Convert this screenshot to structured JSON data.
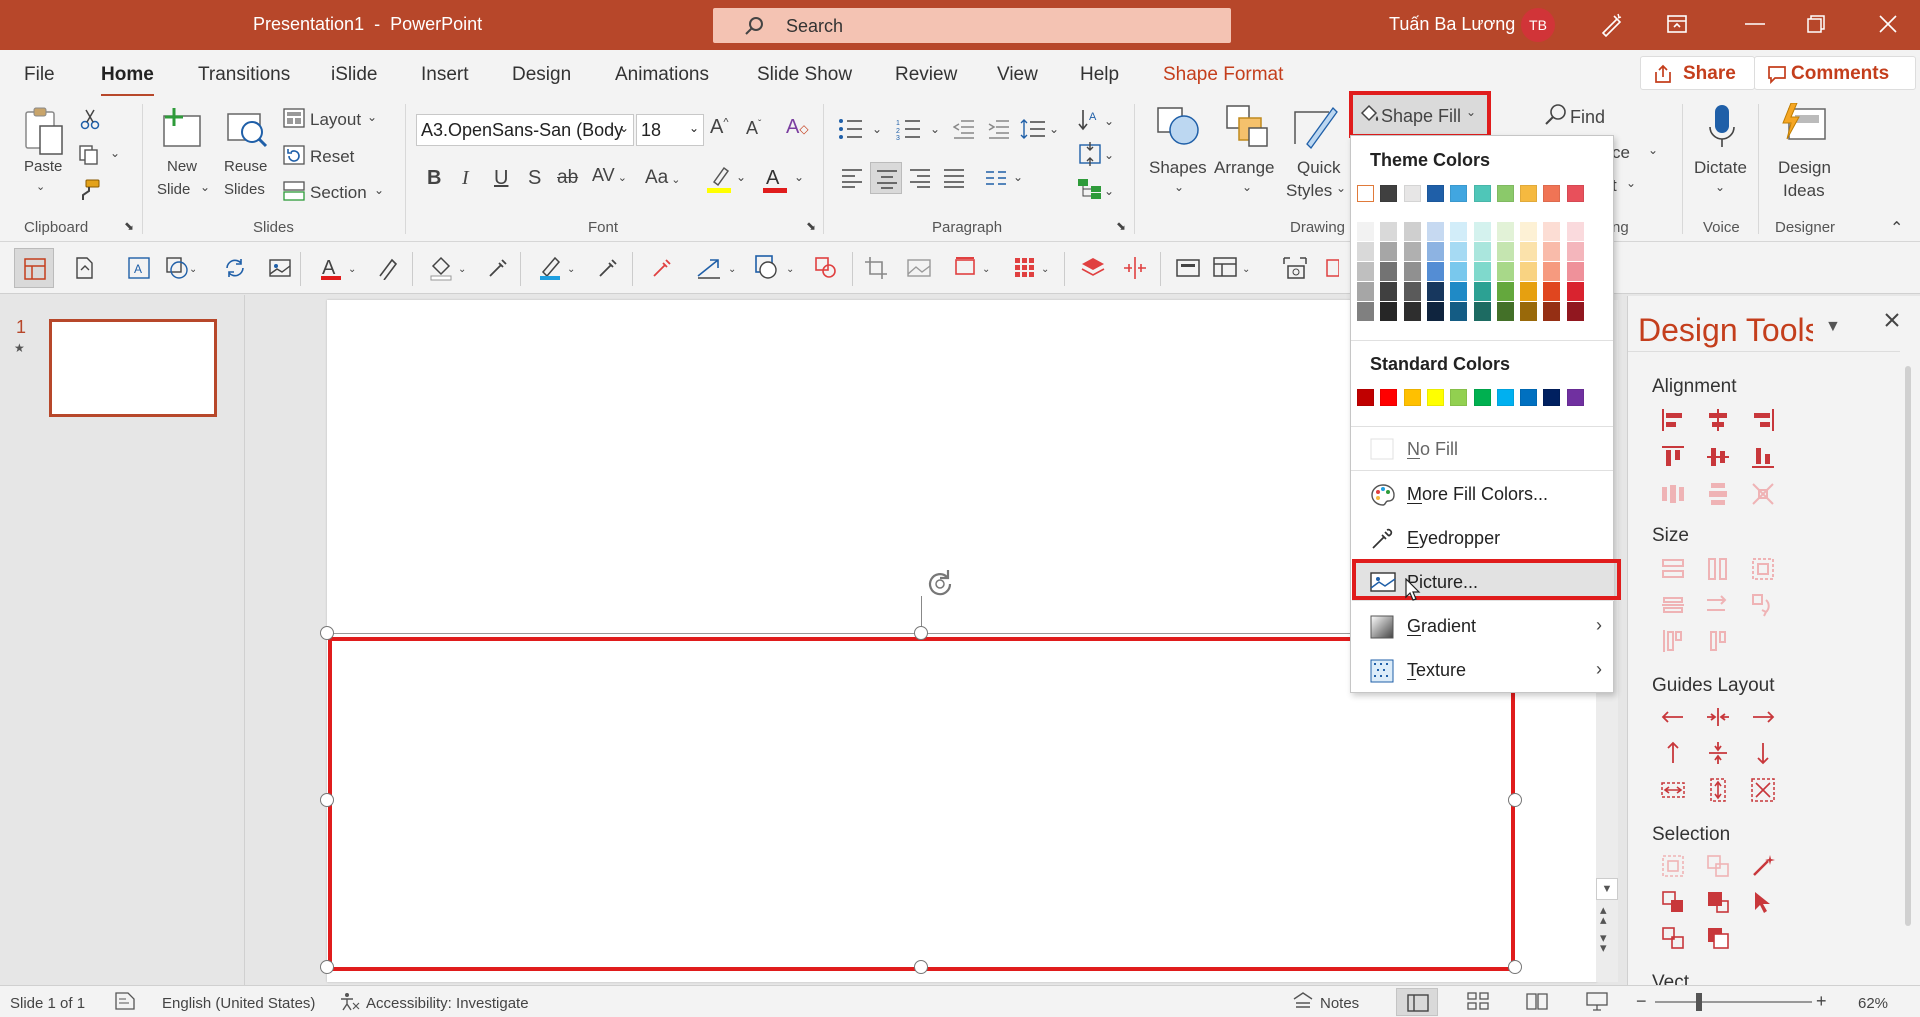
{
  "titlebar": {
    "title": "Presentation1  -  PowerPoint",
    "search_placeholder": "Search",
    "user_name": "Tuấn Ba Lương",
    "user_initials": "TB"
  },
  "tabs": [
    "File",
    "Home",
    "Transitions",
    "iSlide",
    "Insert",
    "Design",
    "Animations",
    "Slide Show",
    "Review",
    "View",
    "Help",
    "Shape Format"
  ],
  "share_label": "Share",
  "comments_label": "Comments",
  "ribbon": {
    "paste": "Paste",
    "new_slide_1": "New",
    "new_slide_2": "Slide",
    "reuse_1": "Reuse",
    "reuse_2": "Slides",
    "layout": "Layout",
    "reset": "Reset",
    "section": "Section",
    "font_name": "A3.OpenSans-San (Body",
    "font_size": "18",
    "shapes": "Shapes",
    "arrange": "Arrange",
    "quick_1": "Quick",
    "quick_2": "Styles",
    "shape_fill": "Shape Fill",
    "find": "Find",
    "frag_ce": "ce",
    "frag_t": "t",
    "frag_ng": "ng",
    "dictate": "Dictate",
    "design_ideas_1": "Design",
    "design_ideas_2": "Ideas",
    "groups": {
      "clipboard": "Clipboard",
      "slides": "Slides",
      "font": "Font",
      "paragraph": "Paragraph",
      "drawing": "Drawing",
      "voice": "Voice",
      "designer": "Designer"
    }
  },
  "thumbnail": {
    "number": "1",
    "star": "★"
  },
  "design_tools": {
    "title": "Design Tools",
    "sections": [
      "Alignment",
      "Size",
      "Guides Layout",
      "Selection",
      "Vect"
    ]
  },
  "dropdown": {
    "theme_colors_label": "Theme Colors",
    "standard_colors_label": "Standard Colors",
    "theme_top": [
      "#ffffff",
      "#404040",
      "#e7e6e6",
      "#1f5fa8",
      "#41a6e0",
      "#4fc6b8",
      "#8bc96a",
      "#f5b940",
      "#f07455",
      "#e8505b"
    ],
    "theme_shades": [
      [
        "#f2f2f2",
        "#d9d9d9",
        "#cfcfcf",
        "#c6d9f1",
        "#d2edf9",
        "#d4f2ee",
        "#e2f2d7",
        "#fdf1d5",
        "#fcddd4",
        "#fadadd"
      ],
      [
        "#d9d9d9",
        "#a6a6a6",
        "#b0b0b0",
        "#8db3e2",
        "#a6daf3",
        "#aae6dd",
        "#c5e5b0",
        "#fbe2ab",
        "#f9bbaa",
        "#f4b6bc"
      ],
      [
        "#bfbfbf",
        "#737373",
        "#909090",
        "#548dd4",
        "#79c8ed",
        "#7fd9cc",
        "#a8d889",
        "#f9d382",
        "#f69a7f",
        "#ef919a"
      ],
      [
        "#a6a6a6",
        "#404040",
        "#5a5a5a",
        "#17375e",
        "#1f8ac6",
        "#2ca193",
        "#64a83d",
        "#e6a010",
        "#e0461f",
        "#d9232f"
      ],
      [
        "#808080",
        "#262626",
        "#2e2e2e",
        "#0f243e",
        "#145c84",
        "#1d6b62",
        "#437028",
        "#99690a",
        "#952f14",
        "#91171f"
      ]
    ],
    "standard": [
      "#c00000",
      "#ff0000",
      "#ffc000",
      "#ffff00",
      "#92d050",
      "#00b050",
      "#00b0f0",
      "#0070c0",
      "#002060",
      "#7030a0"
    ],
    "items": {
      "no_fill": "No Fill",
      "more_colors": "More Fill Colors...",
      "eyedropper": "Eyedropper",
      "picture": "Picture...",
      "gradient": "Gradient",
      "texture": "Texture"
    }
  },
  "statusbar": {
    "slide_info": "Slide 1 of 1",
    "language": "English (United States)",
    "accessibility": "Accessibility: Investigate",
    "notes": "Notes",
    "zoom": "62%",
    "minus": "−",
    "plus": "+"
  },
  "colors": {
    "accent": "#b7472a",
    "highlight": "#e01c1c"
  }
}
